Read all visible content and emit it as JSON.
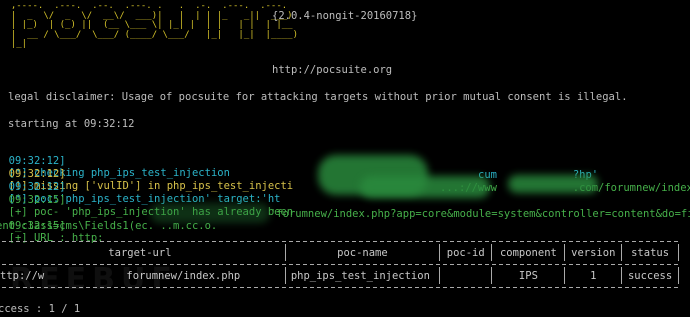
{
  "banner": {
    "art": "  ,----.  .---.  .--.  .---. .   .  .-.  .---.  .---.\n  |  _  \\/  _  \\/  __\\/  ___)|   |  | | |_   _||  ___)\n  | |_)  | (_) ||  (__ \\___ \\| |_| |  | |   | |  | |__\n  |  __ / \\___/  \\___/ (____/ \\___/   |_|   |_|  |____)\n  |_|",
    "version": "{2.0.4-nongit-20160718}",
    "url": "http://pocsuite.org"
  },
  "disclaimer": "legal disclaimer: Usage of pocsuite for attacking targets without prior mutual consent is illegal.",
  "starting": "starting at 09:32:12",
  "logs": [
    {
      "time": "09:32:12]",
      "tag": "[*]",
      "text": " checking php_ips_test_injection",
      "color": "#2bb3c9"
    },
    {
      "time": "09:32:12]",
      "tag": "[!]",
      "text": " missing ['vulID'] in php_ips_test_injecti",
      "color": "#d6c14a"
    },
    {
      "time": "09:32:12]",
      "tag": "[*]",
      "text": " poc:'php_ips_test_injection' target:'ht",
      "tail": "cum            ?hp'",
      "color": "#2bb3c9"
    },
    {
      "time": "09:32:15]",
      "tag": "[+]",
      "text": " poc- 'php_ips_injection' has already been ",
      "tail": "...://www            .com/forumnew/index.",
      "color": "#46b04a"
    },
    {
      "time": "09:32:15]",
      "tag": "[+]",
      "text": " URL : http:",
      "tail": "'forumnew/index.php?app=core&module=system&controller=content&do=find&",
      "color": "#46b04a"
    }
  ],
  "url_cont": "ent_class=cms\\Fields1(ec. ..m.cc.o.",
  "table": {
    "headers": [
      "target-url",
      "poc-name",
      "poc-id",
      "component",
      "version",
      "status"
    ],
    "row": [
      "ttp://w             forumnew/index.php",
      "php_ips_test_injection",
      "",
      "IPS",
      "1",
      "success"
    ]
  },
  "summary": "ccess : 1 / 1",
  "watermark": "REEBUF",
  "colors": {
    "cyan": "#2bb3c9",
    "yellow": "#d6c14a",
    "green": "#46b04a",
    "blur": "#2a8a3d"
  }
}
